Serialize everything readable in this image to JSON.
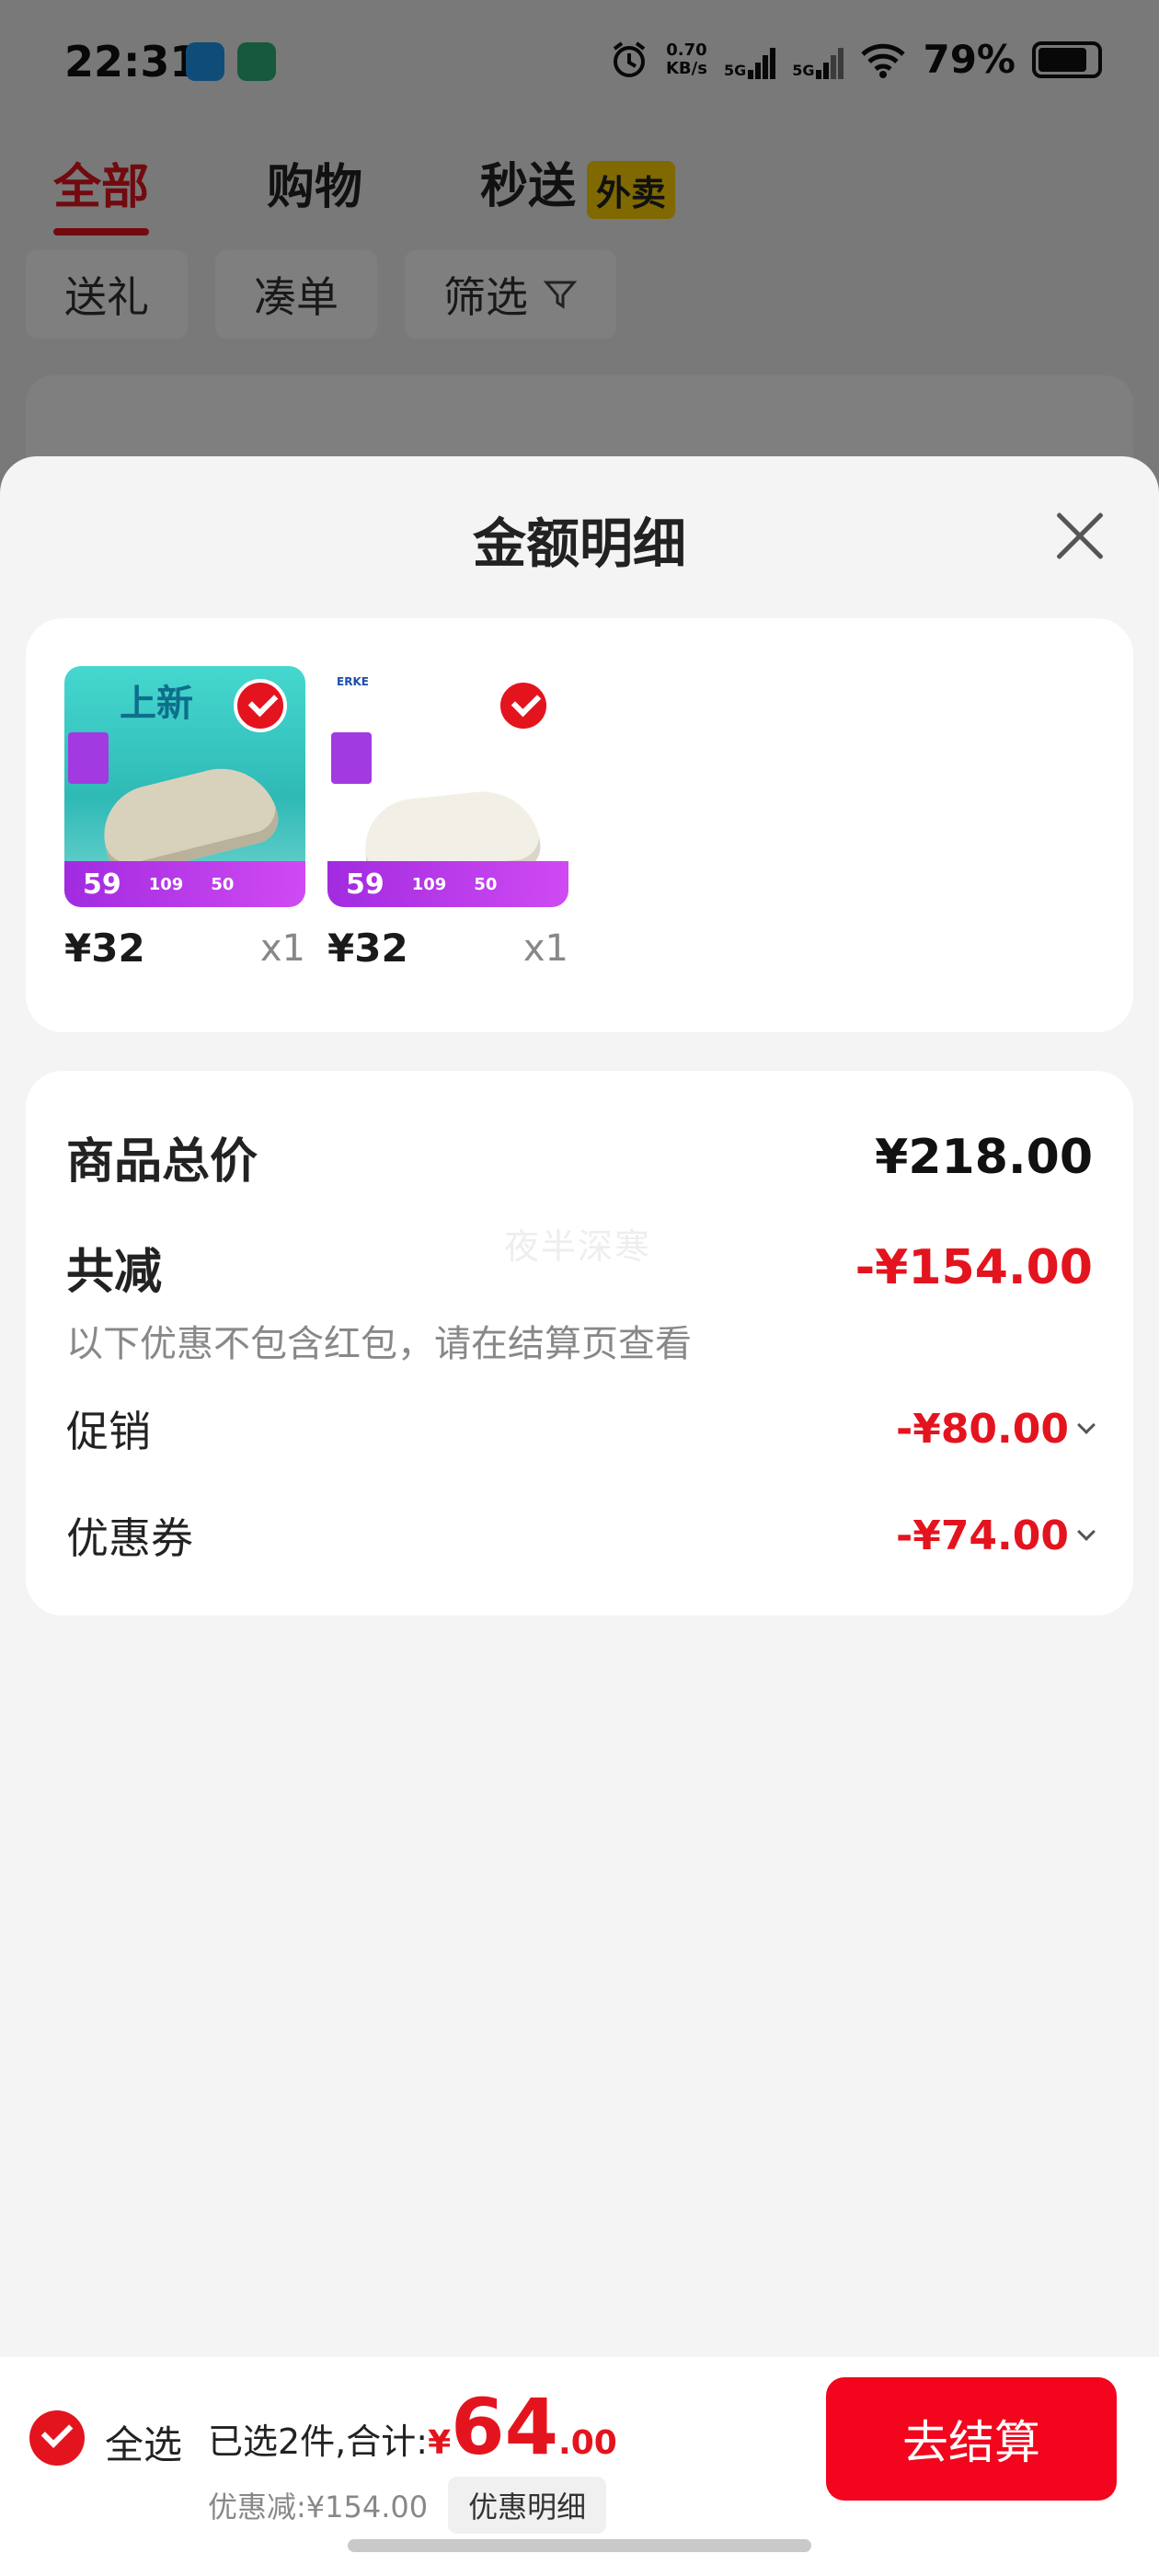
{
  "status_bar": {
    "time": "22:31",
    "net_speed_value": "0.70",
    "net_speed_unit": "KB/s",
    "sig1": "5G",
    "sig2": "5G",
    "battery": "79%"
  },
  "tabs": [
    {
      "label": "全部",
      "active": true
    },
    {
      "label": "购物",
      "active": false
    },
    {
      "label": "秒送",
      "active": false,
      "badge": "外卖"
    }
  ],
  "chips": [
    "送礼",
    "凑单",
    "筛选"
  ],
  "sheet": {
    "title": "金额明细",
    "products": [
      {
        "price": "¥32",
        "qty": "x1",
        "band_price": "59",
        "band_mid": "109",
        "band_right": "50",
        "art_text": "上新"
      },
      {
        "price": "¥32",
        "qty": "x1",
        "band_price": "59",
        "band_mid": "109",
        "band_right": "50",
        "logo": "ERKE"
      }
    ],
    "summary": {
      "total_label": "商品总价",
      "total_value": "¥218.00",
      "reduce_label": "共减",
      "reduce_value": "-¥154.00",
      "note": "以下优惠不包含红包，请在结算页查看",
      "promo_label": "促销",
      "promo_value": "-¥80.00",
      "coupon_label": "优惠券",
      "coupon_value": "-¥74.00",
      "watermark": "夜半深寒"
    }
  },
  "bottom_bar": {
    "select_all": "全选",
    "selected_text": "已选2件,合计:",
    "yen": "¥",
    "total_int": "64",
    "total_dec": ".00",
    "discount_text": "优惠减:¥154.00",
    "detail_button": "优惠明细",
    "checkout": "去结算"
  },
  "colors": {
    "accent_red": "#e4141f",
    "checkout_red": "#f3051d",
    "badge_yellow": "#ffd200"
  }
}
